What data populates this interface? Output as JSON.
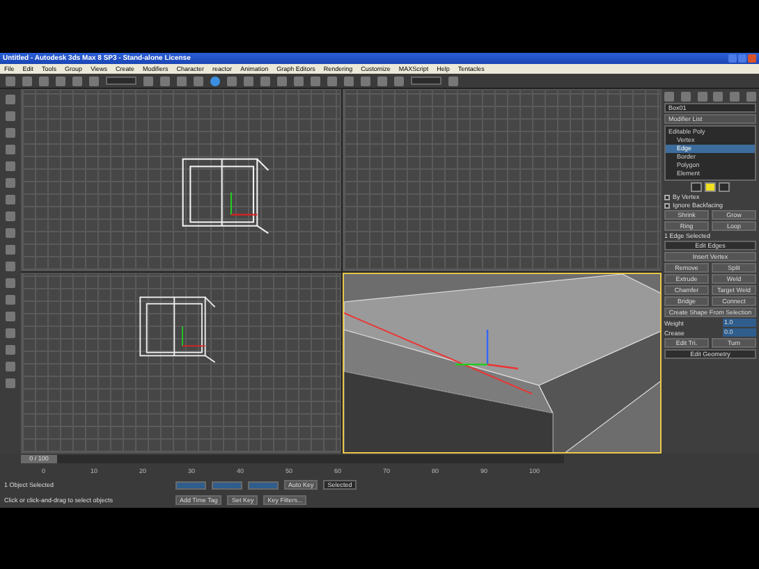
{
  "window": {
    "title": "Untitled - Autodesk 3ds Max 8 SP3 - Stand-alone License"
  },
  "menu": [
    "File",
    "Edit",
    "Tools",
    "Group",
    "Views",
    "Create",
    "Modifiers",
    "Character",
    "reactor",
    "Animation",
    "Graph Editors",
    "Rendering",
    "Customize",
    "MAXScript",
    "Help",
    "Tentacles"
  ],
  "viewports": [
    {
      "kind": "grid",
      "active": false
    },
    {
      "kind": "grid",
      "active": false
    },
    {
      "kind": "grid",
      "active": false
    },
    {
      "kind": "shaded",
      "active": true
    }
  ],
  "command_panel": {
    "object_name": "Box01",
    "modifier_list": "Modifier List",
    "stack": [
      {
        "label": "Editable Poly",
        "selected": false,
        "children": [
          {
            "label": "Vertex",
            "selected": false
          },
          {
            "label": "Edge",
            "selected": true
          },
          {
            "label": "Border",
            "selected": false
          },
          {
            "label": "Polygon",
            "selected": false
          },
          {
            "label": "Element",
            "selected": false
          }
        ]
      }
    ],
    "subobject_levels": [
      {
        "selected": false
      },
      {
        "selected": true
      },
      {
        "selected": false
      }
    ],
    "checkboxes": [
      {
        "label": "By Vertex",
        "checked": false
      },
      {
        "label": "Ignore Backfacing",
        "checked": false
      }
    ],
    "selection_buttons": [
      "Shrink",
      "Grow",
      "Ring",
      "Loop"
    ],
    "selection_info": "1 Edge Selected",
    "rollout_edit_edges": "Edit Edges",
    "insert_vertex": "Insert Vertex",
    "edge_buttons": [
      "Remove",
      "Split",
      "Extrude",
      "Weld",
      "Chamfer",
      "Target Weld",
      "Bridge",
      "Connect"
    ],
    "create_shape": "Create Shape From Selection",
    "spinners": [
      {
        "label": "Weight",
        "value": "1.0"
      },
      {
        "label": "Crease",
        "value": "0.0"
      }
    ],
    "tri_buttons": [
      "Edit Tri.",
      "Turn"
    ],
    "rollout_edit_geometry": "Edit Geometry"
  },
  "timeline": {
    "frame": "0 / 100",
    "level": 0,
    "ticks": [
      "0",
      "10",
      "20",
      "30",
      "40",
      "50",
      "60",
      "70",
      "80",
      "90",
      "100"
    ]
  },
  "status": {
    "selection": "1 Object Selected",
    "prompt": "Click or click-and-drag to select objects",
    "auto_key": "Auto Key",
    "key_mode": "Selected",
    "set_key": "Set Key",
    "key_filters": "Key Filters...",
    "time_tag": "Add Time Tag"
  }
}
